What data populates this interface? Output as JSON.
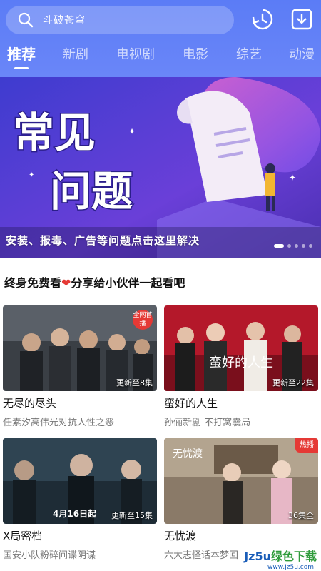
{
  "search": {
    "placeholder": "斗破苍穹",
    "icon": "search-icon"
  },
  "header_icons": [
    "history-icon",
    "download-icon"
  ],
  "tabs": [
    {
      "label": "推荐",
      "active": true
    },
    {
      "label": "新剧",
      "active": false
    },
    {
      "label": "电视剧",
      "active": false
    },
    {
      "label": "电影",
      "active": false
    },
    {
      "label": "综艺",
      "active": false
    },
    {
      "label": "动漫",
      "active": false
    }
  ],
  "banner": {
    "headline_1": "常见",
    "headline_2": "问题",
    "caption": "安装、报毒、广告等问题点击这里解决",
    "slides": 5,
    "active_slide": 1
  },
  "section": {
    "title_a": "终身免费看",
    "heart": "❤",
    "title_b": "分享给小伙伴一起看吧"
  },
  "cards": [
    {
      "title": "无尽的尽头",
      "sub": "任素汐高伟光对抗人性之恶",
      "episode": "更新至8集",
      "poster_text": "",
      "corner": "全网首播"
    },
    {
      "title": "蛮好的人生",
      "sub": "孙俪新剧 不打窝囊局",
      "episode": "更新至22集",
      "poster_text": "蛮好的人生",
      "corner": ""
    },
    {
      "title": "X局密档",
      "sub": "国安小队粉碎间谍阴谋",
      "episode": "更新至15集",
      "poster_text": "4月16日起",
      "corner": ""
    },
    {
      "title": "无忧渡",
      "sub": "六大志怪话本梦回",
      "episode": "36集全",
      "poster_text": "无忧渡",
      "corner": "热播"
    }
  ],
  "watermark": {
    "text_a": "Jz5u",
    "text_b": "绿色下载",
    "url": "www.Jz5u.com"
  },
  "colors": {
    "header": "#5b7cf6",
    "banner": "#5a3fd6",
    "accent_red": "#e53935"
  }
}
